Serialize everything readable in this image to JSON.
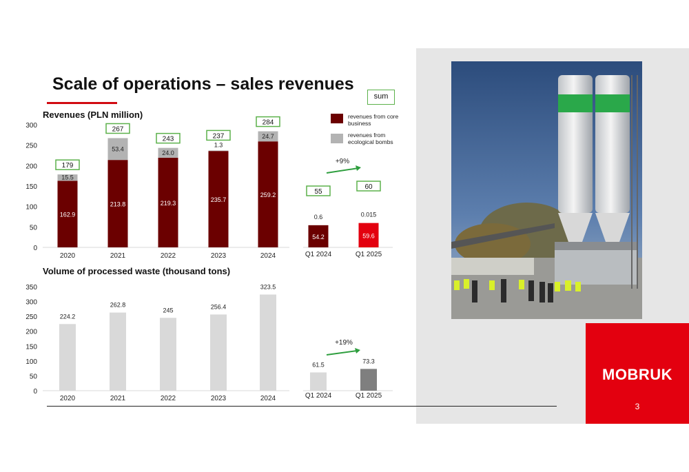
{
  "slide": {
    "title": "Scale of operations – sales revenues",
    "page_number": "3",
    "brand": "MOBRUK",
    "sum_label": "sum"
  },
  "legend": {
    "core": "revenues from core business",
    "eco": "revenues from ecological bombs"
  },
  "colors": {
    "core": "#6b0000",
    "eco": "#b3b3b3",
    "q1_2025_core": "#e3000f",
    "waste": "#d9d9d9",
    "waste_q1_2025": "#7f7f7f",
    "accent": "#d10a11",
    "green": "#2e9e3e"
  },
  "chart_data": [
    {
      "type": "bar",
      "title": "Revenues (PLN million)",
      "categories": [
        "2020",
        "2021",
        "2022",
        "2023",
        "2024"
      ],
      "series": [
        {
          "name": "revenues from core business",
          "values": [
            162.9,
            213.8,
            219.3,
            235.7,
            259.2
          ]
        },
        {
          "name": "revenues from ecological bombs",
          "values": [
            15.5,
            53.4,
            24.0,
            1.3,
            24.7
          ]
        }
      ],
      "totals": [
        179,
        267,
        243,
        237,
        284
      ],
      "value_labels_core": [
        "162.9",
        "213.8",
        "219.3",
        "235.7",
        "259.2"
      ],
      "value_labels_eco": [
        "15.5",
        "53.4",
        "24.0",
        "1.3",
        "24.7"
      ],
      "yticks": [
        0,
        50,
        100,
        150,
        200,
        250,
        300
      ],
      "ylim": [
        0,
        300
      ]
    },
    {
      "type": "bar",
      "categories": [
        "Q1 2024",
        "Q1 2025"
      ],
      "series": [
        {
          "name": "revenues from core business",
          "values": [
            54.2,
            59.6
          ]
        },
        {
          "name": "revenues from ecological bombs",
          "values": [
            0.6,
            0.015
          ]
        }
      ],
      "totals": [
        55,
        60
      ],
      "value_labels_core": [
        "54.2",
        "59.6"
      ],
      "value_labels_eco": [
        "0.6",
        "0.015"
      ],
      "growth_label": "+9%",
      "ylim": [
        0,
        300
      ]
    },
    {
      "type": "bar",
      "title": "Volume of processed waste (thousand tons)",
      "categories": [
        "2020",
        "2021",
        "2022",
        "2023",
        "2024"
      ],
      "values": [
        224.2,
        262.8,
        245,
        256.4,
        323.5
      ],
      "value_labels": [
        "224.2",
        "262.8",
        "245",
        "256.4",
        "323.5"
      ],
      "yticks": [
        0,
        50,
        100,
        150,
        200,
        250,
        300,
        350
      ],
      "ylim": [
        0,
        350
      ]
    },
    {
      "type": "bar",
      "categories": [
        "Q1 2024",
        "Q1 2025"
      ],
      "values": [
        61.5,
        73.3
      ],
      "value_labels": [
        "61.5",
        "73.3"
      ],
      "growth_label": "+19%",
      "ylim": [
        0,
        350
      ]
    }
  ]
}
